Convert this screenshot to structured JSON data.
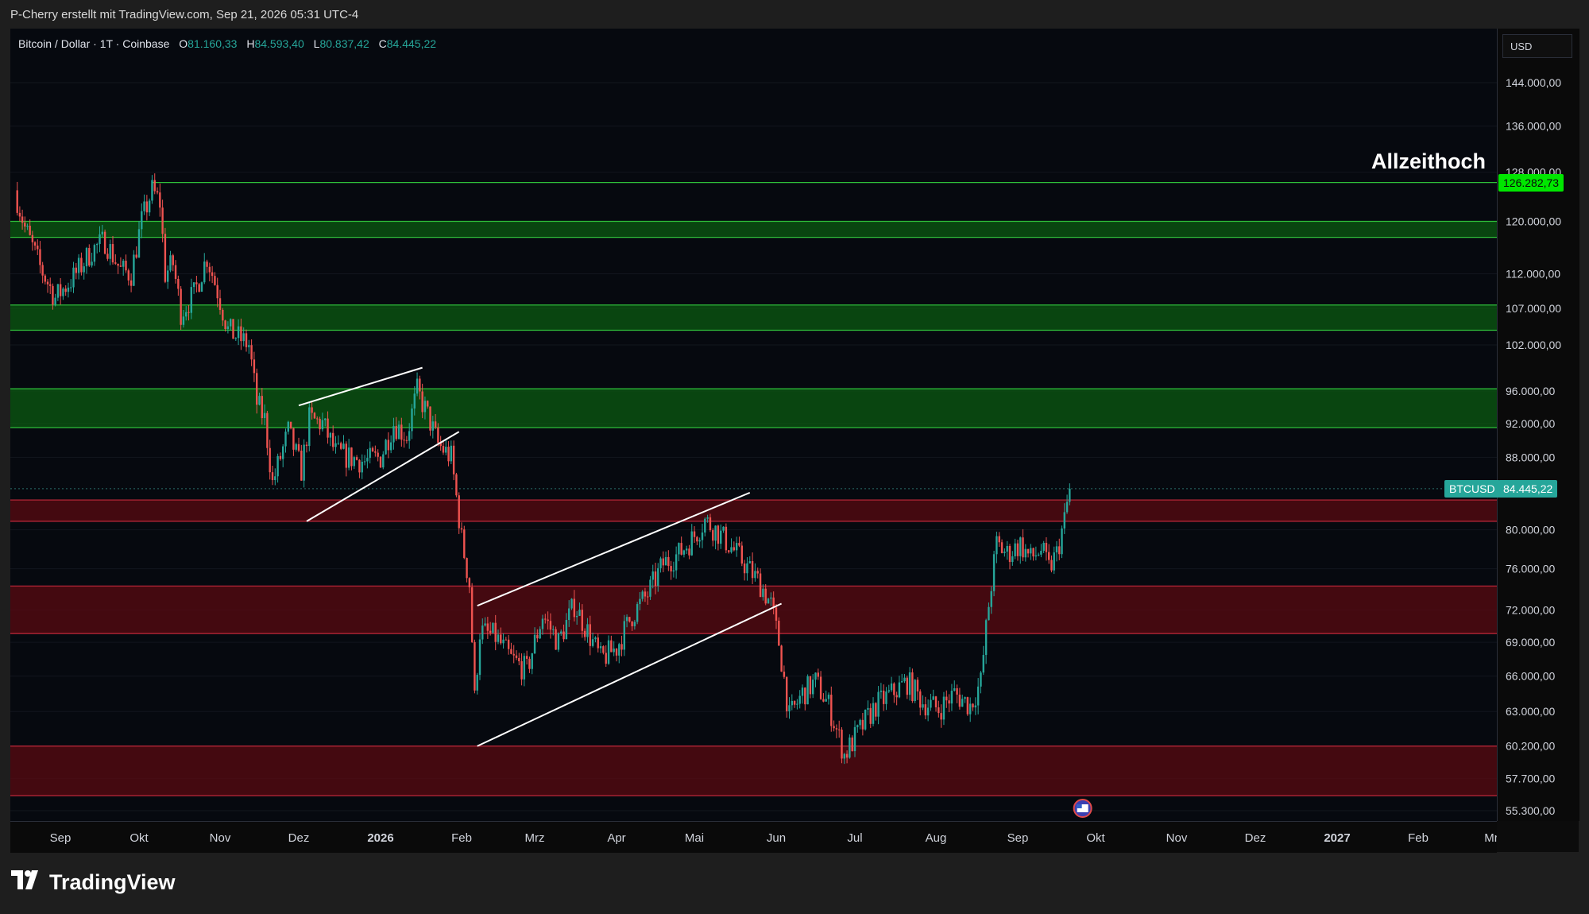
{
  "header": {
    "caption": "P-Cherry erstellt mit TradingView.com, Sep 21, 2026 05:31 UTC-4"
  },
  "legend": {
    "symbol": "Bitcoin / Dollar · 1T · Coinbase",
    "open_label": "O",
    "open": "81.160,33",
    "high_label": "H",
    "high": "84.593,40",
    "low_label": "L",
    "low": "80.837,42",
    "close_label": "C",
    "close": "84.445,22"
  },
  "currency": "USD",
  "annotation": "Allzeithoch",
  "brand": "TradingView",
  "chart_data": {
    "type": "candlestick",
    "symbol": "BTCUSD",
    "x_tick_labels": [
      "Sep",
      "Okt",
      "Nov",
      "Dez",
      "2026",
      "Feb",
      "Mrz",
      "Apr",
      "Mai",
      "Jun",
      "Jul",
      "Aug",
      "Sep",
      "Okt",
      "Nov",
      "Dez",
      "2027",
      "Feb",
      "Mr"
    ],
    "y_tick_labels": [
      "144.000,00",
      "136.000,00",
      "128.000,00",
      "120.000,00",
      "112.000,00",
      "107.000,00",
      "102.000,00",
      "96.000,00",
      "92.000,00",
      "88.000,00",
      "80.000,00",
      "76.000,00",
      "72.000,00",
      "69.000,00",
      "66.000,00",
      "63.000,00",
      "60.200,00",
      "57.700,00",
      "55.300,00"
    ],
    "y_tick_values": [
      144000,
      136000,
      128000,
      120000,
      112000,
      107000,
      102000,
      96000,
      92000,
      88000,
      80000,
      76000,
      72000,
      69000,
      66000,
      63000,
      60200,
      57700,
      55300
    ],
    "y_scale": "log",
    "last_price": {
      "label": "BTCUSD",
      "value": 84445.22,
      "text": "84.445,22",
      "color": "#26a69a"
    },
    "ath_price": {
      "value": 126282.73,
      "text": "126.282,73",
      "color": "#00e600"
    },
    "zones": [
      {
        "kind": "resistance",
        "low": 117500,
        "high": 120000,
        "color": "#0b5a12"
      },
      {
        "kind": "resistance",
        "low": 104000,
        "high": 107500,
        "color": "#0b5a12"
      },
      {
        "kind": "resistance",
        "low": 91500,
        "high": 96300,
        "color": "#0b5a12"
      },
      {
        "kind": "support",
        "low": 80900,
        "high": 83200,
        "color": "#5a0a12"
      },
      {
        "kind": "support",
        "low": 69800,
        "high": 74300,
        "color": "#5a0a12"
      },
      {
        "kind": "support",
        "low": 56400,
        "high": 60200,
        "color": "#5a0a12"
      }
    ],
    "trendlines": [
      {
        "name": "flag-1-upper",
        "from": [
          "2025-12-01",
          94200
        ],
        "to": [
          "2026-01-17",
          99000
        ]
      },
      {
        "name": "flag-1-lower",
        "from": [
          "2025-12-04",
          80900
        ],
        "to": [
          "2026-01-31",
          91000
        ]
      },
      {
        "name": "channel-upper",
        "from": [
          "2026-02-07",
          72400
        ],
        "to": [
          "2026-05-22",
          84000
        ]
      },
      {
        "name": "channel-lower",
        "from": [
          "2026-02-07",
          60200
        ],
        "to": [
          "2026-06-03",
          72600
        ]
      }
    ],
    "price_path": [
      [
        "2025-08-14",
        125000
      ],
      [
        "2025-08-18",
        119000
      ],
      [
        "2025-08-24",
        113000
      ],
      [
        "2025-08-30",
        108500
      ],
      [
        "2025-09-06",
        111500
      ],
      [
        "2025-09-13",
        115500
      ],
      [
        "2025-09-18",
        117000
      ],
      [
        "2025-09-24",
        112500
      ],
      [
        "2025-09-28",
        112000
      ],
      [
        "2025-10-02",
        120000
      ],
      [
        "2025-10-06",
        125000
      ],
      [
        "2025-10-09",
        123000
      ],
      [
        "2025-10-11",
        112000
      ],
      [
        "2025-10-14",
        113500
      ],
      [
        "2025-10-17",
        106500
      ],
      [
        "2025-10-22",
        109000
      ],
      [
        "2025-10-27",
        114500
      ],
      [
        "2025-10-31",
        109500
      ],
      [
        "2025-11-04",
        104000
      ],
      [
        "2025-11-08",
        103000
      ],
      [
        "2025-11-12",
        102000
      ],
      [
        "2025-11-15",
        94500
      ],
      [
        "2025-11-18",
        92500
      ],
      [
        "2025-11-21",
        85000
      ],
      [
        "2025-11-24",
        88000
      ],
      [
        "2025-11-27",
        91000
      ],
      [
        "2025-12-02",
        86500
      ],
      [
        "2025-12-05",
        92500
      ],
      [
        "2025-12-10",
        92000
      ],
      [
        "2025-12-15",
        88500
      ],
      [
        "2025-12-20",
        88000
      ],
      [
        "2025-12-26",
        87500
      ],
      [
        "2026-01-01",
        88000
      ],
      [
        "2026-01-06",
        92000
      ],
      [
        "2026-01-11",
        90500
      ],
      [
        "2026-01-15",
        96000
      ],
      [
        "2026-01-19",
        93000
      ],
      [
        "2026-01-23",
        89500
      ],
      [
        "2026-01-28",
        88000
      ],
      [
        "2026-02-01",
        79000
      ],
      [
        "2026-02-04",
        74500
      ],
      [
        "2026-02-06",
        64000
      ],
      [
        "2026-02-08",
        70000
      ],
      [
        "2026-02-14",
        69500
      ],
      [
        "2026-02-20",
        67500
      ],
      [
        "2026-02-26",
        66500
      ],
      [
        "2026-03-04",
        71500
      ],
      [
        "2026-03-10",
        69000
      ],
      [
        "2026-03-16",
        72500
      ],
      [
        "2026-03-20",
        70500
      ],
      [
        "2026-03-26",
        67500
      ],
      [
        "2026-04-01",
        68500
      ],
      [
        "2026-04-07",
        71500
      ],
      [
        "2026-04-13",
        73500
      ],
      [
        "2026-04-19",
        76500
      ],
      [
        "2026-04-25",
        77500
      ],
      [
        "2026-04-30",
        79000
      ],
      [
        "2026-05-05",
        81000
      ],
      [
        "2026-05-09",
        80000
      ],
      [
        "2026-05-14",
        78500
      ],
      [
        "2026-05-20",
        76500
      ],
      [
        "2026-05-26",
        74500
      ],
      [
        "2026-05-30",
        72500
      ],
      [
        "2026-06-02",
        69000
      ],
      [
        "2026-06-06",
        62500
      ],
      [
        "2026-06-11",
        64500
      ],
      [
        "2026-06-16",
        65500
      ],
      [
        "2026-06-21",
        63500
      ],
      [
        "2026-06-27",
        59500
      ],
      [
        "2026-07-03",
        61500
      ],
      [
        "2026-07-09",
        63500
      ],
      [
        "2026-07-15",
        64500
      ],
      [
        "2026-07-21",
        65500
      ],
      [
        "2026-07-27",
        63800
      ],
      [
        "2026-08-02",
        63200
      ],
      [
        "2026-08-08",
        64500
      ],
      [
        "2026-08-14",
        63500
      ],
      [
        "2026-08-18",
        65500
      ],
      [
        "2026-08-21",
        72500
      ],
      [
        "2026-08-24",
        78500
      ],
      [
        "2026-08-28",
        77500
      ],
      [
        "2026-09-02",
        78500
      ],
      [
        "2026-09-06",
        77000
      ],
      [
        "2026-09-10",
        78000
      ],
      [
        "2026-09-13",
        76000
      ],
      [
        "2026-09-16",
        77500
      ],
      [
        "2026-09-19",
        81000
      ],
      [
        "2026-09-21",
        84445.22
      ]
    ],
    "colors": {
      "up": "#26a69a",
      "down": "#ef5350",
      "trendline": "#ffffff"
    }
  }
}
